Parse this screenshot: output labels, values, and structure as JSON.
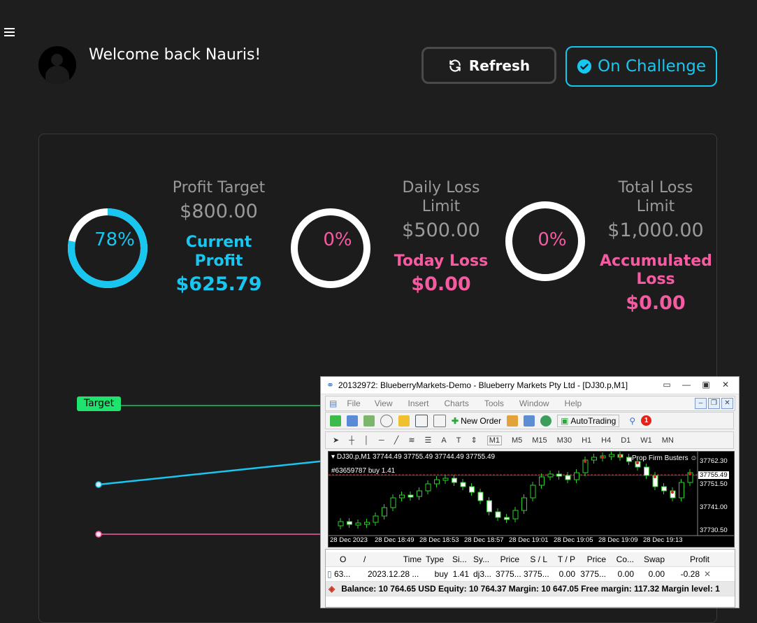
{
  "header": {
    "welcome": "Welcome back Nauris!",
    "refresh_label": "Refresh",
    "challenge_label": "On Challenge"
  },
  "stats": [
    {
      "ring_value": "78%",
      "ring_color": "#18c6f0",
      "ring_progress": 0.78,
      "label": "Profit Target",
      "value": "$800.00",
      "label2": "Current Profit",
      "value2": "$625.79"
    },
    {
      "ring_value": "0%",
      "ring_color": "#f65ba1",
      "ring_progress": 0,
      "label": "Daily Loss Limit",
      "value": "$500.00",
      "label2": "Today Loss",
      "value2": "$0.00"
    },
    {
      "ring_value": "0%",
      "ring_color": "#f65ba1",
      "ring_progress": 0,
      "label": "Total Loss Limit",
      "value": "$1,000.00",
      "label2": "Accumulated Loss",
      "value2": "$0.00"
    }
  ],
  "chart": {
    "target_label": "Target",
    "colors": {
      "target": "#1ee36c",
      "equity": "#18c6f0",
      "loss": "#f65ba1"
    }
  },
  "mt4": {
    "title": "20132972: BlueberryMarkets-Demo - Blueberry Markets Pty Ltd - [DJ30.p,M1]",
    "menu": [
      "File",
      "View",
      "Insert",
      "Charts",
      "Tools",
      "Window",
      "Help"
    ],
    "toolbar": {
      "new_order": "New Order",
      "autotrading": "AutoTrading",
      "alert_count": "1"
    },
    "timeframes": [
      "M1",
      "M5",
      "M15",
      "M30",
      "H1",
      "H4",
      "D1",
      "W1",
      "MN"
    ],
    "chart_header": "DJ30.p,M1  37744.49 37755.49 37744.49 37755.49",
    "order_line": "#63659787 buy 1.41",
    "ea_label": "Prop Firm Busters",
    "price_ticks": [
      "37762.30",
      "37755.49",
      "37751.50",
      "37741.00",
      "37730.50"
    ],
    "time_ticks": [
      "28 Dec 2023",
      "28 Dec 18:49",
      "28 Dec 18:53",
      "28 Dec 18:57",
      "28 Dec 19:01",
      "28 Dec 19:05",
      "28 Dec 19:09",
      "28 Dec 19:13"
    ],
    "columns": [
      "Or...",
      "/",
      "Time",
      "Type",
      "Si...",
      "Sy...",
      "Price",
      "S / L",
      "T / P",
      "Price",
      "Co...",
      "Swap",
      "Profit"
    ],
    "order_row": [
      "63...",
      "2023.12.28 ...",
      "buy",
      "1.41",
      "dj3...",
      "3775...",
      "3775...",
      "0.00",
      "3775...",
      "0.00",
      "0.00",
      "-0.28"
    ],
    "balance_line": "Balance: 10 764.65 USD  Equity: 10 764.37  Margin: 10 647.05  Free margin: 117.32  Margin level: 1"
  }
}
